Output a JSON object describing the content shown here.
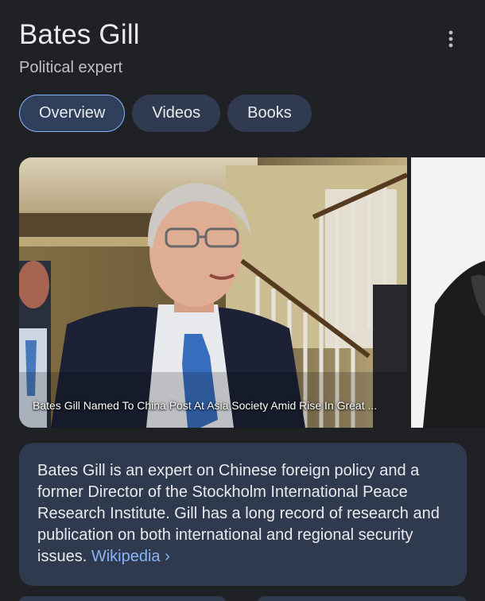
{
  "header": {
    "title": "Bates Gill",
    "subtitle": "Political expert"
  },
  "tabs": [
    {
      "label": "Overview",
      "active": true
    },
    {
      "label": "Videos",
      "active": false
    },
    {
      "label": "Books",
      "active": false
    }
  ],
  "images": {
    "main_caption": "Bates Gill Named To China Post At Asia Society Amid Rise In Great ..."
  },
  "description": {
    "text": "Bates Gill is an expert on Chinese foreign policy and a former Director of the Stockholm International Peace Research Institute. Gill has a long record of research and publication on both international and regional security issues.",
    "source_link": "Wikipedia",
    "chevron": "›"
  },
  "colors": {
    "background": "#202124",
    "card": "#303a4e",
    "tab": "#303b52",
    "link": "#8ab4f8"
  },
  "icons": {
    "more": "more-vert-icon",
    "chevron": "chevron-right-icon"
  }
}
